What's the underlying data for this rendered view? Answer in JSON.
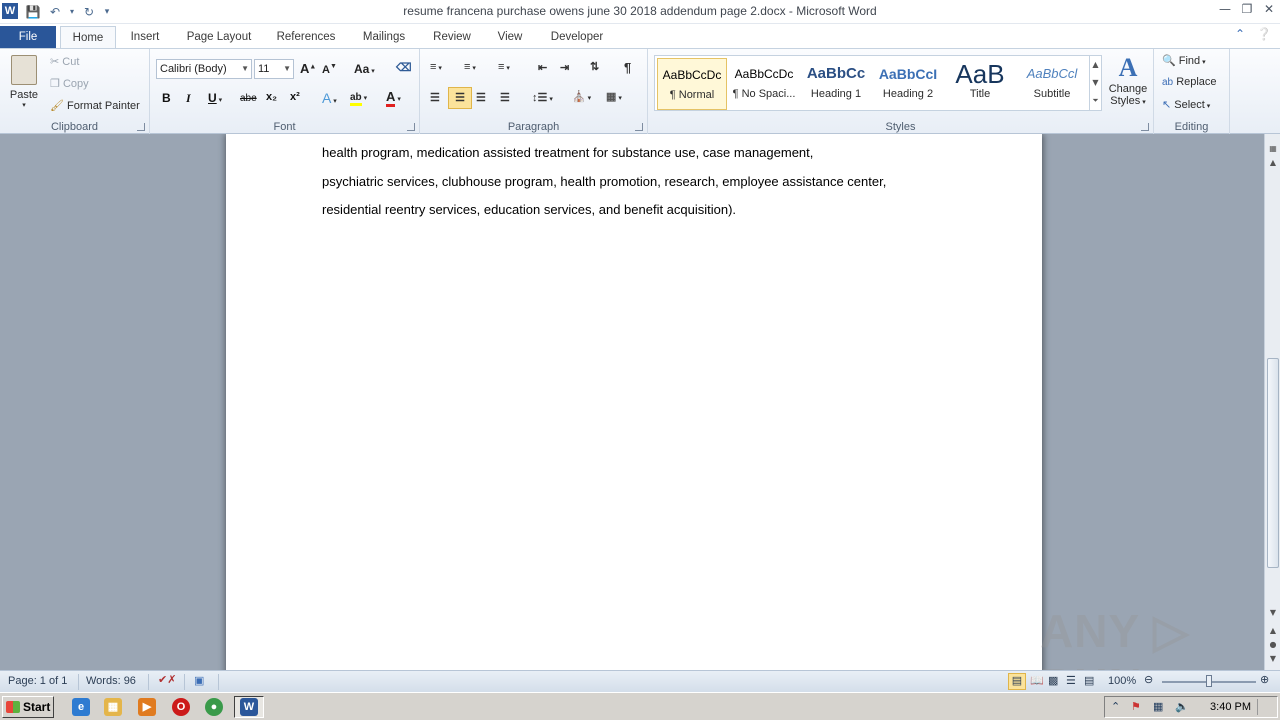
{
  "window": {
    "title": "resume francena purchase owens june 30 2018 addendum page 2.docx - Microsoft Word",
    "app_logo": "W"
  },
  "tabs": [
    "File",
    "Home",
    "Insert",
    "Page Layout",
    "References",
    "Mailings",
    "Review",
    "View",
    "Developer"
  ],
  "ribbon": {
    "clipboard": {
      "label": "Clipboard",
      "paste": "Paste",
      "cut": "Cut",
      "copy": "Copy",
      "format_painter": "Format Painter"
    },
    "font": {
      "label": "Font",
      "font_name": "Calibri (Body)",
      "font_size": "11",
      "bold": "B",
      "italic": "I",
      "underline": "U",
      "strike": "abe",
      "subscript": "x₂",
      "superscript": "x²",
      "grow": "A",
      "shrink": "A",
      "change_case": "Aa",
      "font_color": "A",
      "highlight": "ab"
    },
    "paragraph": {
      "label": "Paragraph",
      "pilcrow": "¶"
    },
    "styles": {
      "label": "Styles",
      "items": [
        {
          "sample": "AaBbCcDc",
          "name": "¶ Normal"
        },
        {
          "sample": "AaBbCcDc",
          "name": "¶ No Spaci..."
        },
        {
          "sample": "AaBbCc",
          "name": "Heading 1"
        },
        {
          "sample": "AaBbCcI",
          "name": "Heading 2"
        },
        {
          "sample": "AaB",
          "name": "Title"
        },
        {
          "sample": "AaBbCcl",
          "name": "Subtitle"
        }
      ],
      "change_styles_1": "Change",
      "change_styles_2": "Styles"
    },
    "editing": {
      "label": "Editing",
      "find": "Find",
      "replace": "Replace",
      "select": "Select"
    }
  },
  "document": {
    "lines": [
      "health program, medication assisted treatment for substance use, case management,",
      "psychiatric services, clubhouse program, health promotion, research, employee assistance center,",
      "residential reentry services, education services, and benefit acquisition)."
    ]
  },
  "watermark": "ANY ▷ RUN",
  "statusbar": {
    "page": "Page: 1 of 1",
    "words": "Words: 96",
    "zoom": "100%",
    "zoom_level_fraction": 0.5
  },
  "taskbar": {
    "start": "Start",
    "clock": "3:40 PM"
  },
  "colors": {
    "file_tab": "#2a5699",
    "page_background": "#9aa5b3",
    "selected_style": "#fff8d8"
  }
}
